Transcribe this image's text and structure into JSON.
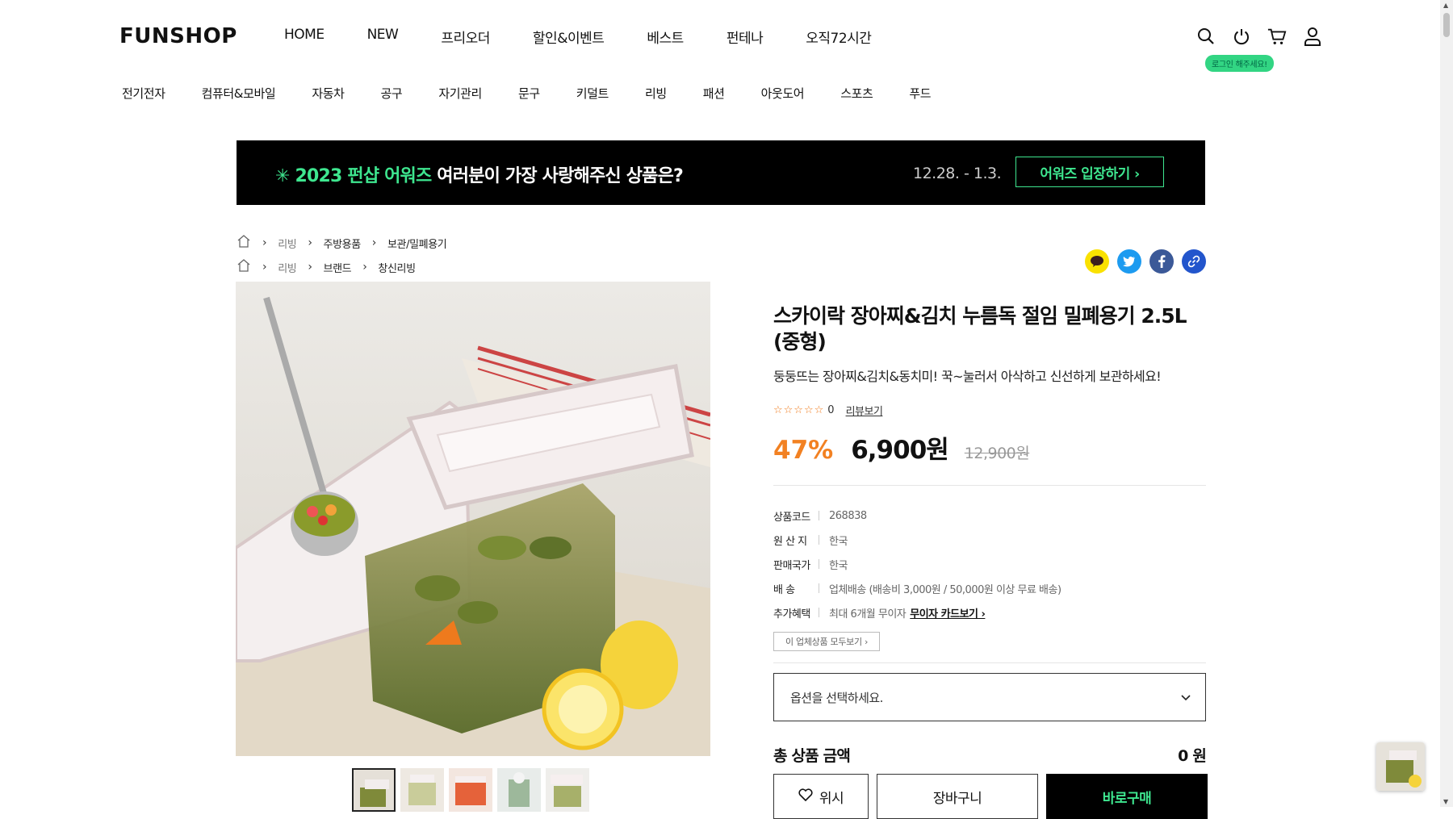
{
  "header": {
    "logo": "FUNSHOP",
    "main_nav": [
      "HOME",
      "NEW",
      "프리오더",
      "할인&이벤트",
      "베스트",
      "펀테나",
      "오직72시간"
    ],
    "login_tip": "로그인 해주세요!",
    "icons": [
      "search-icon",
      "power-icon",
      "cart-icon",
      "user-icon"
    ]
  },
  "category_nav": [
    "전기전자",
    "컴퓨터&모바일",
    "자동차",
    "공구",
    "자기관리",
    "문구",
    "키덜트",
    "리빙",
    "패션",
    "아웃도어",
    "스포츠",
    "푸드"
  ],
  "banner": {
    "prefix": "✳ 2023 펀샵 어워즈",
    "text": " 여러분이 가장 사랑해주신 상품은?",
    "date": "12.28. - 1.3.",
    "button": "어워즈 입장하기 ›"
  },
  "breadcrumbs": [
    [
      "리빙",
      "주방용품",
      "보관/밀폐용기"
    ],
    [
      "리빙",
      "브랜드",
      "창신리빙"
    ]
  ],
  "share_icons": [
    "kakaotalk-icon",
    "twitter-icon",
    "facebook-icon",
    "link-icon"
  ],
  "product": {
    "title": "스카이락 장아찌&김치 누름독 절임 밀폐용기 2.5L (중형)",
    "subtitle": "둥둥뜨는 장아찌&김치&동치미! 꾹~눌러서 아삭하고 신선하게 보관하세요!",
    "stars": "☆☆☆☆☆",
    "review_count": "0",
    "review_link": "리뷰보기",
    "discount_rate": "47%",
    "price": "6,900원",
    "original_price": "12,900원",
    "specs": {
      "code_label": "상품코드",
      "code": "268838",
      "origin_label": "원 산 지",
      "origin": "한국",
      "country_label": "판매국가",
      "country": "한국",
      "ship_label": "배 송",
      "ship": "업체배송 (배송비 3,000원 / 50,000원 이상 무료 배송)",
      "benefit_label": "추가혜택",
      "benefit": "최대 6개월 무이자",
      "benefit_link": "무이자 카드보기 ›"
    },
    "vendor_button": "이 업체상품 모두보기 ›",
    "option_placeholder": "옵션을 선택하세요.",
    "total_label": "총 상품 금액",
    "total_value": "0 원",
    "wish_button": "위시",
    "cart_button": "장바구니",
    "buy_button": "바로구매"
  },
  "colors": {
    "accent_green": "#3ee68f",
    "discount_orange": "#f28122"
  }
}
